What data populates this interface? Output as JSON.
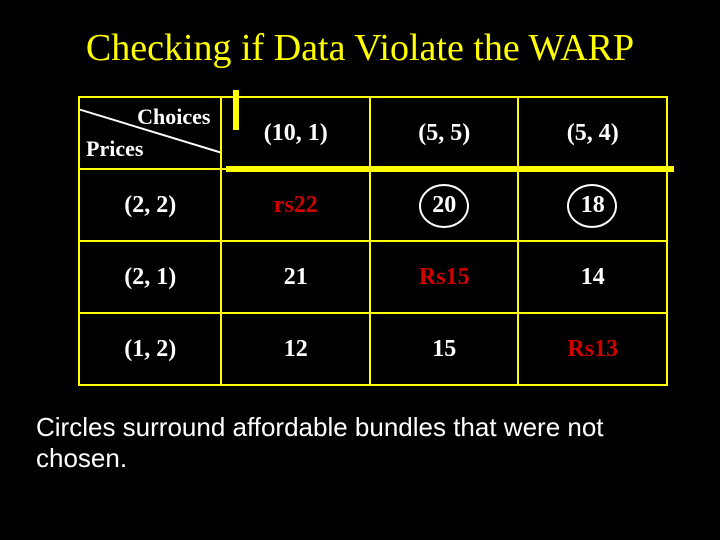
{
  "title": "Checking if Data Violate the WARP",
  "header": {
    "choices_label": "Choices",
    "prices_label": "Prices",
    "col1": "(10, 1)",
    "col2": "(5, 5)",
    "col3": "(5, 4)"
  },
  "rows": [
    {
      "price": "(2, 2)",
      "c1": "rs22",
      "c2": "20",
      "c3": "18"
    },
    {
      "price": "(2, 1)",
      "c1": "21",
      "c2": "Rs15",
      "c3": "14"
    },
    {
      "price": "(1, 2)",
      "c1": "12",
      "c2": "15",
      "c3": "Rs13"
    }
  ],
  "caption": "Circles surround affordable bundles that were not chosen.",
  "chart_data": {
    "type": "table",
    "title": "Expenditure table for WARP check",
    "row_labels_title": "Prices",
    "col_labels_title": "Choices",
    "columns": [
      "(10, 1)",
      "(5, 5)",
      "(5, 4)"
    ],
    "rows": [
      "(2, 2)",
      "(2, 1)",
      "(1, 2)"
    ],
    "values": [
      [
        22,
        20,
        18
      ],
      [
        21,
        15,
        14
      ],
      [
        12,
        15,
        13
      ]
    ],
    "diagonal_is_chosen_bundle_cost": true,
    "diagonal_labels": [
      "rs22",
      "Rs15",
      "Rs13"
    ],
    "circled_cells": [
      [
        0,
        1
      ],
      [
        0,
        2
      ]
    ],
    "circled_meaning": "affordable bundles that were not chosen"
  }
}
